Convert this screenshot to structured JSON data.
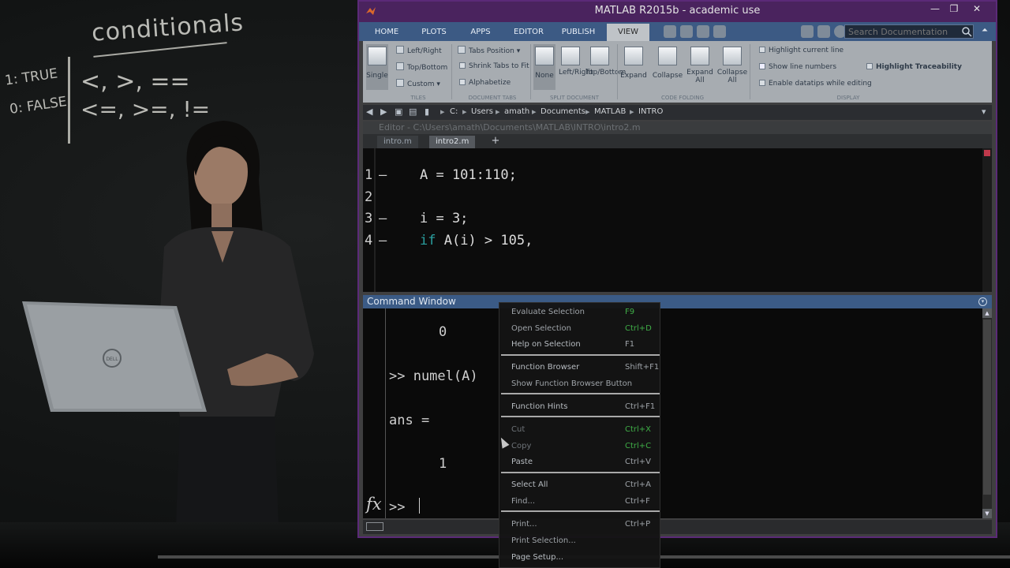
{
  "chalkboard": {
    "title": "conditionals",
    "true_label": "1: TRUE",
    "false_label": "0: FALSE",
    "operators_line1": "<, >, ==",
    "operators_line2": "<=, >=, !="
  },
  "laptop": {
    "brand": "DELL"
  },
  "window": {
    "title": "MATLAB R2015b - academic use",
    "controls": [
      "—",
      "❐",
      "✕"
    ]
  },
  "ribbon_tabs": [
    "HOME",
    "PLOTS",
    "APPS",
    "EDITOR",
    "PUBLISH",
    "VIEW"
  ],
  "active_tab": "VIEW",
  "search": {
    "placeholder": "Search Documentation"
  },
  "ribbon": {
    "tiles": {
      "single": "Single",
      "left_right": "Left/Right",
      "top_bottom": "Top/Bottom",
      "custom": "Custom",
      "group": "TILES"
    },
    "document_tabs": {
      "tabs_position": "Tabs Position",
      "shrink_tabs": "Shrink Tabs to Fit",
      "alphabetize": "Alphabetize",
      "group": "DOCUMENT TABS"
    },
    "split_document": {
      "none": "None",
      "left_right": "Left/Right",
      "top_bottom": "Top/Bottom",
      "group": "SPLIT DOCUMENT"
    },
    "code_folding": {
      "expand": "Expand",
      "collapse": "Collapse",
      "expand_all": "Expand All",
      "collapse_all": "Collapse All",
      "group": "CODE FOLDING"
    },
    "display": {
      "highlight_current_line": "Highlight current line",
      "show_line_numbers": "Show line numbers",
      "enable_datatips": "Enable datatips while editing",
      "highlight_traceability": "Highlight Traceability",
      "group": "DISPLAY"
    }
  },
  "address": {
    "drive": "C:",
    "crumbs": [
      "Users",
      "amath",
      "Documents",
      "MATLAB",
      "INTRO"
    ]
  },
  "editor": {
    "header": "Editor - C:\\Users\\amath\\Documents\\MATLAB\\INTRO\\intro2.m",
    "tabs": [
      "intro.m",
      "intro2.m"
    ],
    "active_tab": "intro2.m",
    "lines": [
      {
        "num": "1",
        "dash": "–",
        "code": "A = 101:110;"
      },
      {
        "num": "2",
        "dash": "",
        "code": ""
      },
      {
        "num": "3",
        "dash": "–",
        "code": "i = 3;"
      },
      {
        "num": "4",
        "dash": "–",
        "kw": "if",
        "code": " A(i) > 105,"
      }
    ]
  },
  "command_window": {
    "title": "Command Window",
    "lines": [
      "0",
      ">> numel(A)",
      "ans =",
      "1"
    ],
    "prompt": ">>",
    "fx": "fx"
  },
  "context_menu": [
    {
      "label": "Evaluate Selection",
      "shortcut": "F9",
      "green": true
    },
    {
      "label": "Open Selection",
      "shortcut": "Ctrl+D",
      "green": true
    },
    {
      "label": "Help on Selection",
      "shortcut": "F1",
      "green": false
    },
    {
      "label": "Function Browser",
      "shortcut": "Shift+F1",
      "green": false
    },
    {
      "label": "Show Function Browser Button",
      "shortcut": "",
      "green": false
    },
    {
      "label": "Function Hints",
      "shortcut": "Ctrl+F1",
      "green": false
    },
    {
      "label": "Cut",
      "shortcut": "Ctrl+X",
      "green": true
    },
    {
      "label": "Copy",
      "shortcut": "Ctrl+C",
      "green": true
    },
    {
      "label": "Paste",
      "shortcut": "Ctrl+V",
      "green": false
    },
    {
      "label": "Select All",
      "shortcut": "Ctrl+A",
      "green": false
    },
    {
      "label": "Find...",
      "shortcut": "Ctrl+F",
      "green": false
    },
    {
      "label": "Print...",
      "shortcut": "Ctrl+P",
      "green": false
    },
    {
      "label": "Print Selection...",
      "shortcut": "",
      "green": false
    },
    {
      "label": "Page Setup...",
      "shortcut": "",
      "green": false
    }
  ],
  "colors": {
    "titlebar": "#4a235e",
    "tabstrip": "#3c5a84",
    "keyword": "#2aa0a0",
    "shortcut_green": "#3fae47"
  }
}
